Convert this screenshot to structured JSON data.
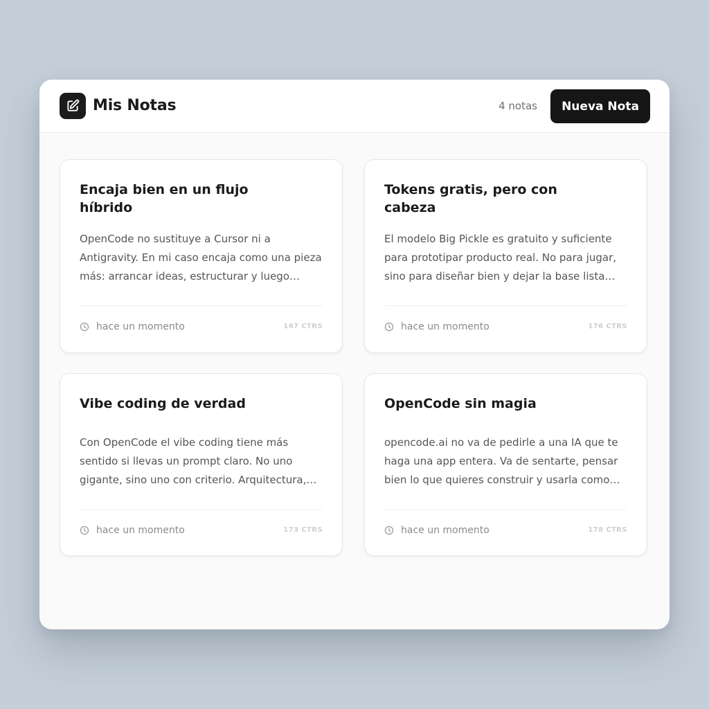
{
  "header": {
    "title": "Mis Notas",
    "count_label": "4 notas",
    "new_note_label": "Nueva Nota",
    "icon": "edit-note-icon"
  },
  "notes": [
    {
      "title": "Encaja bien en un flujo híbrido",
      "body": "OpenCode no sustituye a Cursor ni a Antigravity. En mi caso encaja como una pieza más: arrancar ideas, estructurar y luego seguir…",
      "time": "hace un momento",
      "chars": "167 CTRS"
    },
    {
      "title": "Tokens gratis, pero con cabeza",
      "body": "El modelo Big Pickle es gratuito y suficiente para prototipar producto real. No para jugar, sino para diseñar bien y dejar la base lista par…",
      "time": "hace un momento",
      "chars": "176 CTRS"
    },
    {
      "title": "Vibe coding de verdad",
      "body": "Con OpenCode el vibe coding tiene más sentido si llevas un prompt claro. No uno gigante, sino uno con criterio. Arquitectura,…",
      "time": "hace un momento",
      "chars": "173 CTRS"
    },
    {
      "title": "OpenCode sin magia",
      "body": "opencode.ai no va de pedirle a una IA que te haga una app entera. Va de sentarte, pensar bien lo que quieres construir y usarla como…",
      "time": "hace un momento",
      "chars": "178 CTRS"
    }
  ],
  "colors": {
    "background": "#c5cfd9",
    "accent": "#161616",
    "card": "#ffffff"
  }
}
